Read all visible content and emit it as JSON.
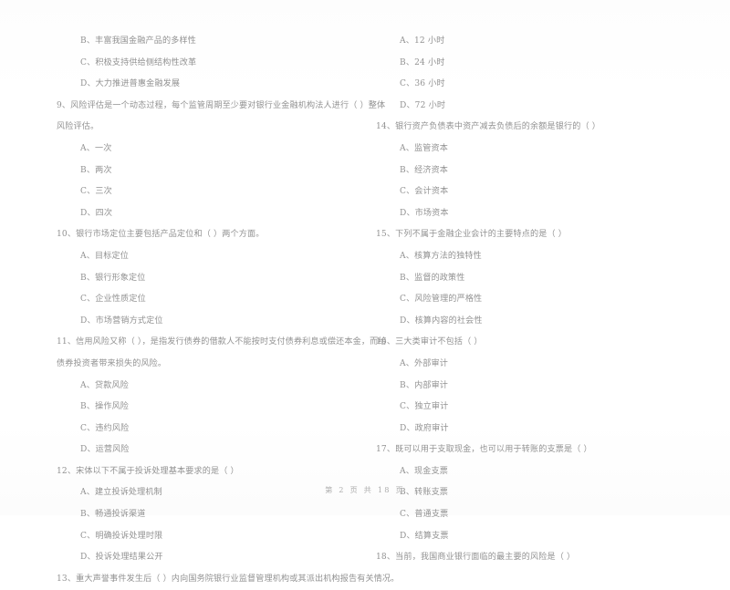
{
  "document": {
    "type": "exam-paper",
    "language": "zh-CN",
    "footer": "第 2 页 共 18 页"
  },
  "left_column": {
    "continued_options": [
      "B、丰富我国金融产品的多样性",
      "C、积极支持供给侧结构性改革",
      "D、大力推进普惠金融发展"
    ],
    "questions": [
      {
        "number": "9",
        "stem_line1": "9、风险评估是一个动态过程，每个监管周期至少要对银行业金融机构法人进行（      ）整体",
        "stem_line2": "风险评估。",
        "options": [
          "A、一次",
          "B、两次",
          "C、三次",
          "D、四次"
        ]
      },
      {
        "number": "10",
        "stem_line1": "10、银行市场定位主要包括产品定位和（      ）两个方面。",
        "stem_line2": "",
        "options": [
          "A、目标定位",
          "B、银行形象定位",
          "C、企业性质定位",
          "D、市场营销方式定位"
        ]
      },
      {
        "number": "11",
        "stem_line1": "11、信用风险又称（      ），是指发行债券的借款人不能按时支付债券利息或偿还本金，而给",
        "stem_line2": "债券投资者带来损失的风险。",
        "options": [
          "A、贷款风险",
          "B、操作风险",
          "C、违约风险",
          "D、运营风险"
        ]
      },
      {
        "number": "12",
        "stem_line1": "12、宋体以下不属于投诉处理基本要求的是（      ）",
        "stem_line2": "",
        "options": [
          "A、建立投诉处理机制",
          "B、畅通投诉渠道",
          "C、明确投诉处理时限",
          "D、投诉处理结果公开"
        ]
      },
      {
        "number": "13",
        "stem_line1": "13、重大声誉事件发生后（      ）内向国务院银行业监督管理机构或其派出机构报告有关情况。",
        "stem_line2": "",
        "options": []
      }
    ]
  },
  "right_column": {
    "continued_options": [
      "A、12 小时",
      "B、24 小时",
      "C、36 小时",
      "D、72 小时"
    ],
    "questions": [
      {
        "number": "14",
        "stem_line1": "14、银行资产负债表中资产减去负债后的余额是银行的（      ）",
        "stem_line2": "",
        "options": [
          "A、监管资本",
          "B、经济资本",
          "C、会计资本",
          "D、市场资本"
        ]
      },
      {
        "number": "15",
        "stem_line1": "15、下列不属于金融企业会计的主要特点的是（      ）",
        "stem_line2": "",
        "options": [
          "A、核算方法的独特性",
          "B、监督的政策性",
          "C、风险管理的严格性",
          "D、核算内容的社会性"
        ]
      },
      {
        "number": "16",
        "stem_line1": "16、三大类审计不包括（      ）",
        "stem_line2": "",
        "options": [
          "A、外部审计",
          "B、内部审计",
          "C、独立审计",
          "D、政府审计"
        ]
      },
      {
        "number": "17",
        "stem_line1": "17、既可以用于支取现金，也可以用于转账的支票是（      ）",
        "stem_line2": "",
        "options": [
          "A、现金支票",
          "B、转账支票",
          "C、普通支票",
          "D、结算支票"
        ]
      },
      {
        "number": "18",
        "stem_line1": "18、当前，我国商业银行面临的最主要的风险是（      ）",
        "stem_line2": "",
        "options": []
      }
    ]
  }
}
